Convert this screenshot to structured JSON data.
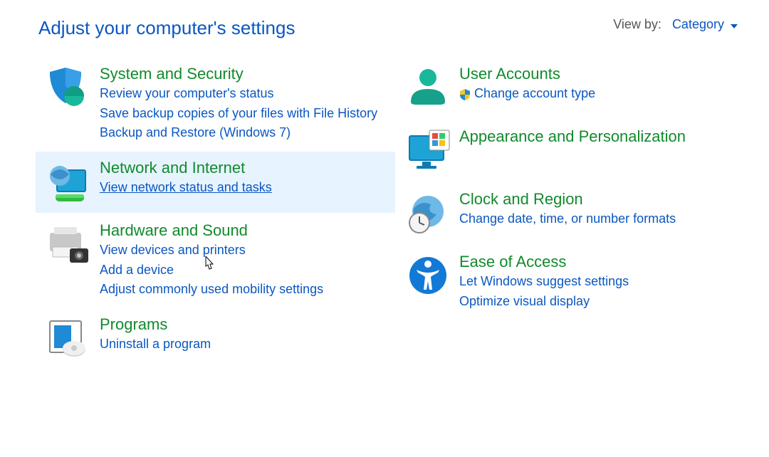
{
  "header": {
    "title": "Adjust your computer's settings",
    "viewby_label": "View by:",
    "viewby_value": "Category"
  },
  "left": [
    {
      "id": "system-security",
      "title": "System and Security",
      "links": [
        {
          "id": "review-status",
          "text": "Review your computer's status"
        },
        {
          "id": "file-history",
          "text": "Save backup copies of your files with File History"
        },
        {
          "id": "backup-restore",
          "text": "Backup and Restore (Windows 7)"
        }
      ]
    },
    {
      "id": "network-internet",
      "title": "Network and Internet",
      "selected": true,
      "links": [
        {
          "id": "view-network",
          "text": "View network status and tasks",
          "underline": true
        }
      ]
    },
    {
      "id": "hardware-sound",
      "title": "Hardware and Sound",
      "links": [
        {
          "id": "devices-printers",
          "text": "View devices and printers"
        },
        {
          "id": "add-device",
          "text": "Add a device"
        },
        {
          "id": "mobility",
          "text": "Adjust commonly used mobility settings"
        }
      ]
    },
    {
      "id": "programs",
      "title": "Programs",
      "links": [
        {
          "id": "uninstall",
          "text": "Uninstall a program"
        }
      ]
    }
  ],
  "right": [
    {
      "id": "user-accounts",
      "title": "User Accounts",
      "links": [
        {
          "id": "change-account",
          "text": "Change account type",
          "shield": true
        }
      ]
    },
    {
      "id": "appearance",
      "title": "Appearance and Personalization",
      "links": []
    },
    {
      "id": "clock-region",
      "title": "Clock and Region",
      "links": [
        {
          "id": "date-time",
          "text": "Change date, time, or number formats"
        }
      ]
    },
    {
      "id": "ease-access",
      "title": "Ease of Access",
      "links": [
        {
          "id": "suggest",
          "text": "Let Windows suggest settings"
        },
        {
          "id": "optimize",
          "text": "Optimize visual display"
        }
      ]
    }
  ]
}
